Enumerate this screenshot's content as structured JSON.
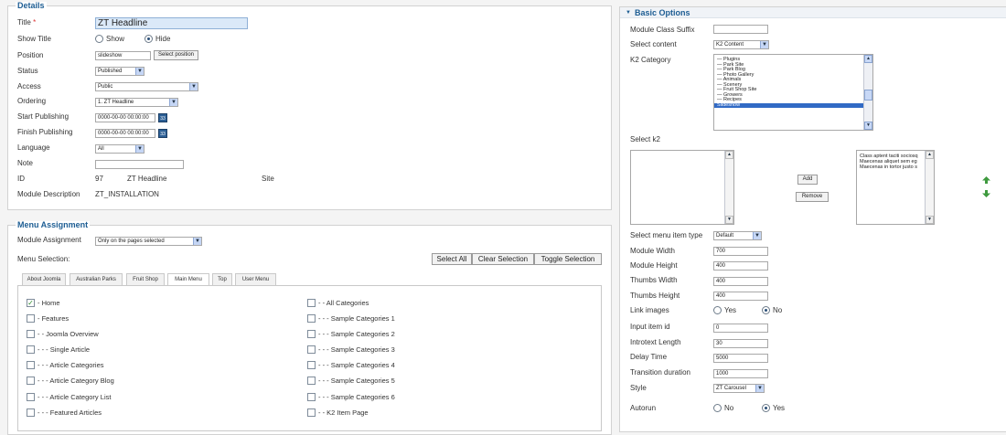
{
  "details": {
    "legend": "Details",
    "title_label": "Title",
    "title_required": "*",
    "title_value": "ZT Headline",
    "show_title_label": "Show Title",
    "show_title_opt1": "Show",
    "show_title_opt2": "Hide",
    "position_label": "Position",
    "position_value": "slideshow",
    "select_position_btn": "Select position",
    "status_label": "Status",
    "status_value": "Published",
    "access_label": "Access",
    "access_value": "Public",
    "ordering_label": "Ordering",
    "ordering_value": "1. ZT Headline",
    "start_label": "Start Publishing",
    "start_value": "0000-00-00 00:00:00",
    "finish_label": "Finish Publishing",
    "finish_value": "0000-00-00 00:00:00",
    "calendar_icon": "33",
    "language_label": "Language",
    "language_value": "All",
    "note_label": "Note",
    "note_value": "",
    "id_label": "ID",
    "id_value": "97",
    "id_name": "ZT Headline",
    "id_site": "Site",
    "desc_label": "Module Description",
    "desc_value": "ZT_INSTALLATION"
  },
  "menu": {
    "legend": "Menu Assignment",
    "assignment_label": "Module Assignment",
    "assignment_value": "Only on the pages selected",
    "selection_label": "Menu Selection:",
    "select_all": "Select All",
    "clear_selection": "Clear Selection",
    "toggle_selection": "Toggle Selection",
    "tabs": [
      "About Joomla",
      "Australian Parks",
      "Fruit Shop",
      "Main Menu",
      "Top",
      "User Menu"
    ],
    "left_items": [
      "- Home",
      "- Features",
      "- - Joomla Overview",
      "- - - Single Article",
      "- - - Article Categories",
      "- - - Article Category Blog",
      "- - - Article Category List",
      "- - - Featured Articles"
    ],
    "right_items": [
      "- - All Categories",
      "- - - Sample Categories 1",
      "- - - Sample Categories 2",
      "- - - Sample Categories 3",
      "- - - Sample Categories 4",
      "- - - Sample Categories 5",
      "- - - Sample Categories 6",
      "- - K2 Item Page"
    ]
  },
  "basic": {
    "legend": "Basic Options",
    "toggle_glyph": "▼",
    "suffix_label": "Module Class Suffix",
    "suffix_value": "",
    "content_label": "Select content",
    "content_value": "K2 Content",
    "k2cat_label": "K2 Category",
    "k2cat_options": [
      "— Plugins",
      "— Park Site",
      "— Park Blog",
      "— Photo Gallery",
      "— Animals",
      "— Scenery",
      "— Fruit Shop Site",
      "— Growers",
      "— Recipes",
      "Slideshow"
    ],
    "selectk2_label": "Select k2",
    "add_btn": "Add",
    "remove_btn": "Remove",
    "selected_items": [
      "Class aptent taciti sociosq",
      "Maecenas aliquet sem eg",
      "Maecenas in tortor justo s"
    ],
    "menu_type_label": "Select menu item type",
    "menu_type_value": "Default",
    "module_width_label": "Module Width",
    "module_width_value": "700",
    "module_height_label": "Module Height",
    "module_height_value": "400",
    "thumbs_width_label": "Thumbs Width",
    "thumbs_width_value": "400",
    "thumbs_height_label": "Thumbs Height",
    "thumbs_height_value": "400",
    "link_images_label": "Link images",
    "yes": "Yes",
    "no": "No",
    "input_item_label": "Input item id",
    "input_item_value": "0",
    "introtext_label": "Introtext Length",
    "introtext_value": "30",
    "delay_label": "Delay Time",
    "delay_value": "5000",
    "transition_label": "Transition duration",
    "transition_value": "1000",
    "style_label": "Style",
    "style_value": "ZT Carousel",
    "autorun_label": "Autorun",
    "up_arrow_color": "#3f9a3f",
    "down_arrow_color": "#3f9a3f"
  }
}
